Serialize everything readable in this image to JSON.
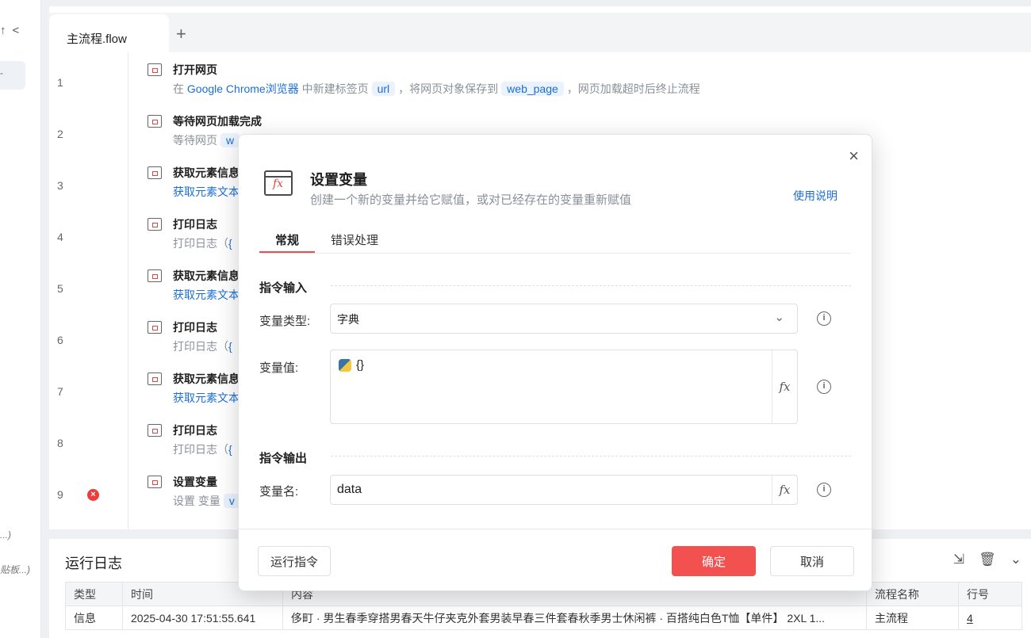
{
  "sidebar": {
    "nav_up": "↑",
    "nav_back": "<",
    "selected_marker": "-",
    "fragment_1": "...)",
    "fragment_2": "贴板...)"
  },
  "editor": {
    "tab_label": "主流程.flow",
    "add_tab": "+",
    "rows": [
      {
        "num": "1",
        "title": "打开网页",
        "d1": "在 ",
        "d2": "Google Chrome浏览器",
        "d3": " 中新建标签页",
        "c1": "url",
        "d4": "，将网页对象保存到",
        "c2": "web_page",
        "d5": "，网页加载超时后终止流程"
      },
      {
        "num": "2",
        "title": "等待网页加载完成",
        "d1": "等待网页",
        "c1": "w"
      },
      {
        "num": "3",
        "title": "获取元素信息",
        "d1": "获取元素文本"
      },
      {
        "num": "4",
        "title": "打印日志",
        "d1": "打印日志（",
        "d2": "{"
      },
      {
        "num": "5",
        "title": "获取元素信息",
        "d1": "获取元素文本"
      },
      {
        "num": "6",
        "title": "打印日志",
        "d1": "打印日志（",
        "d2": "{"
      },
      {
        "num": "7",
        "title": "获取元素信息",
        "d1": "获取元素文本"
      },
      {
        "num": "8",
        "title": "打印日志",
        "d1": "打印日志（",
        "d2": "{"
      },
      {
        "num": "9",
        "title": "设置变量",
        "d1": "设置 变量",
        "c1": "v",
        "error": "×"
      }
    ]
  },
  "log": {
    "title": "运行日志",
    "export_icon": "⇲",
    "delete_icon": "🗑",
    "collapse_icon": "⌄",
    "headers": [
      "类型",
      "时间",
      "内容",
      "流程名称",
      "行号"
    ],
    "rows": [
      [
        "信息",
        "2025-04-30 17:51:55.641",
        "侈町 · 男生春季穿搭男春天牛仔夹克外套男装早春三件套春秋季男士休闲裤 · 百搭纯白色T恤【单件】 2XL 1...",
        "主流程",
        "4"
      ]
    ]
  },
  "dialog": {
    "close": "×",
    "icon_text": "fx",
    "title": "设置变量",
    "subtitle": "创建一个新的变量并给它赋值，或对已经存在的变量重新赋值",
    "help": "使用说明",
    "tabs": [
      "常规",
      "错误处理"
    ],
    "section_input": "指令输入",
    "var_type_label": "变量类型:",
    "var_type_value": "字典",
    "var_value_label": "变量值:",
    "var_value": "{}",
    "section_output": "指令输出",
    "var_name_label": "变量名:",
    "var_name_value": "data",
    "fx": "fx",
    "info": "i",
    "run_button": "运行指令",
    "ok_button": "确定",
    "cancel_button": "取消"
  }
}
